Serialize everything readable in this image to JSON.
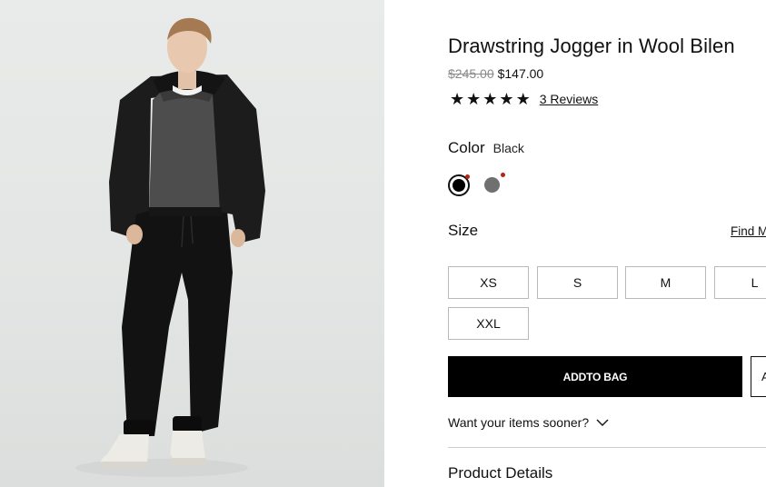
{
  "product": {
    "title": "Drawstring Jogger in Wool Bilen",
    "price_original": "$245.00",
    "price_sale": "$147.00",
    "rating": {
      "stars": 5,
      "reviews_label": "3 Reviews"
    },
    "image_alt": "Model wearing black hooded jacket, grey sweater, black drawstring joggers and white sneakers"
  },
  "color": {
    "label": "Color",
    "selected": "Black",
    "swatches": [
      {
        "name": "Black",
        "hex": "#000000",
        "selected": true
      },
      {
        "name": "Grey",
        "hex": "#707070",
        "selected": false
      }
    ],
    "indicator_hex": "#b42318"
  },
  "size": {
    "label": "Size",
    "find_link": "Find M",
    "options": [
      "XS",
      "S",
      "M",
      "L",
      "XXL"
    ]
  },
  "actions": {
    "add_to_bag": "ADDTO BAG",
    "secondary": "A"
  },
  "shipping": {
    "sooner_label": "Want your items sooner?"
  },
  "sections": {
    "product_details": "Product Details"
  }
}
